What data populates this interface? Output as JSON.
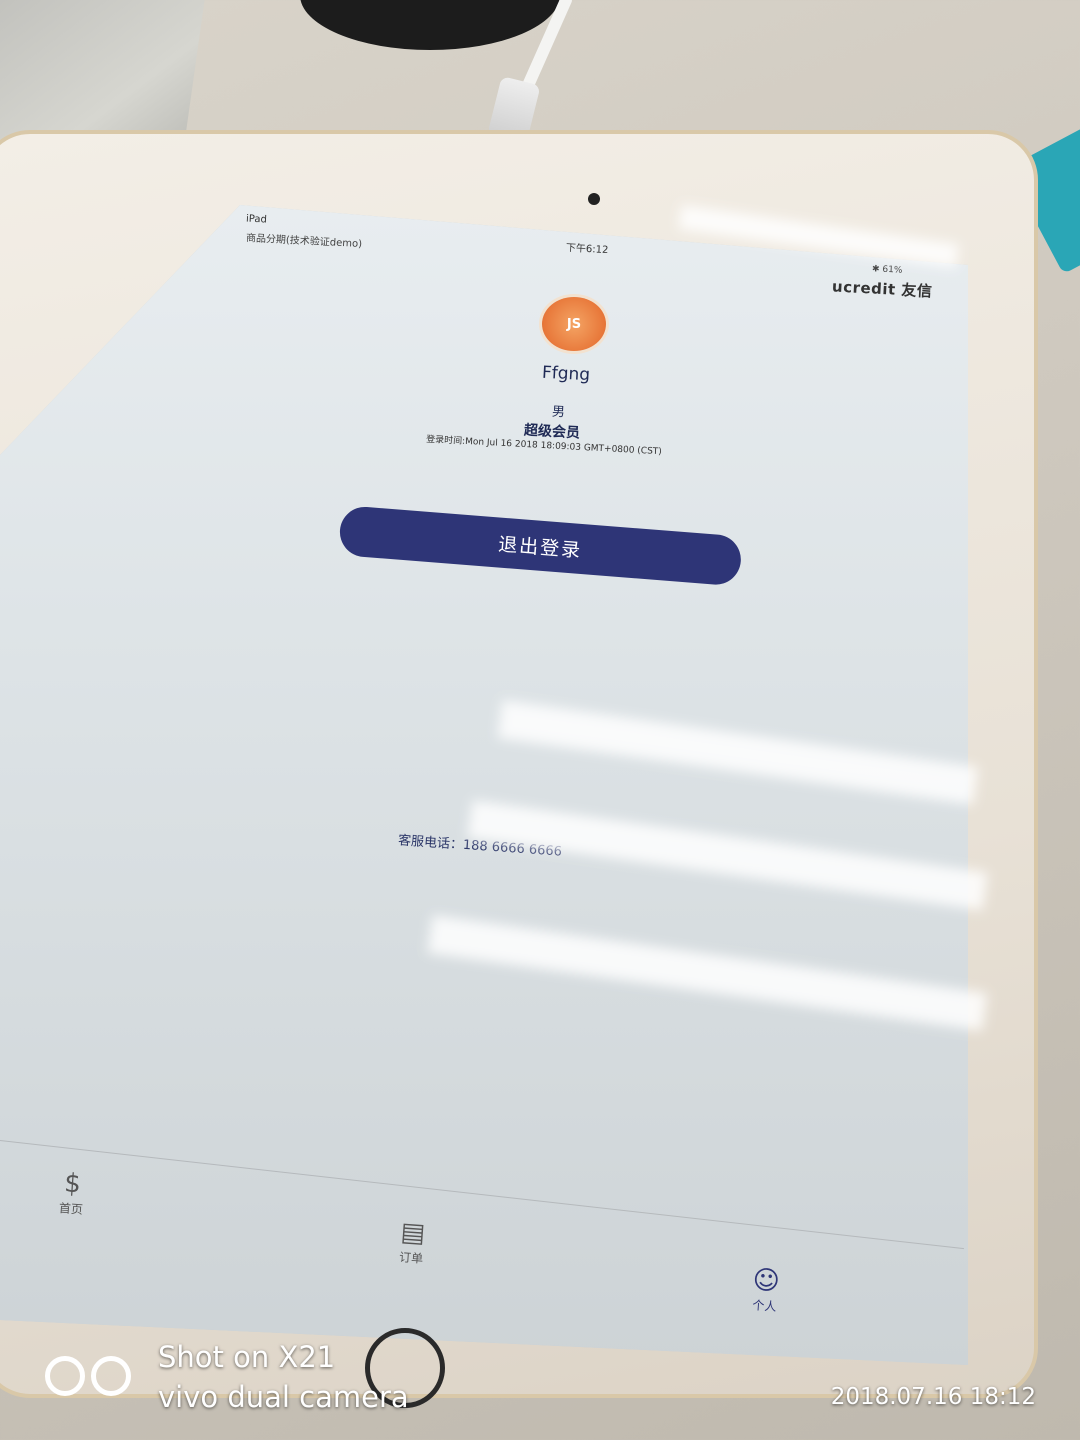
{
  "status_bar": {
    "device": "iPad",
    "app_subtitle": "商品分期(技术验证demo)",
    "time": "下午6:12",
    "right": "✱ 61%"
  },
  "brand": "ucredit 友信",
  "profile": {
    "avatar_text": "JS",
    "username": "Ffgng",
    "gender": "男",
    "member_level": "超级会员",
    "login_time": "登录时间:Mon Jul 16 2018 18:09:03 GMT+0800 (CST)"
  },
  "logout_button": "退出登录",
  "service_phone": "客服电话：188 6666 6666",
  "tabs": [
    {
      "label": "首页",
      "icon": "money-bag-icon",
      "glyph": "$"
    },
    {
      "label": "订单",
      "icon": "order-list-icon",
      "glyph": "▤"
    },
    {
      "label": "个人",
      "icon": "smiley-icon",
      "glyph": "☺"
    }
  ],
  "watermark": {
    "line1": "Shot on X21",
    "line2": "vivo dual camera",
    "datetime": "2018.07.16 18:12"
  }
}
